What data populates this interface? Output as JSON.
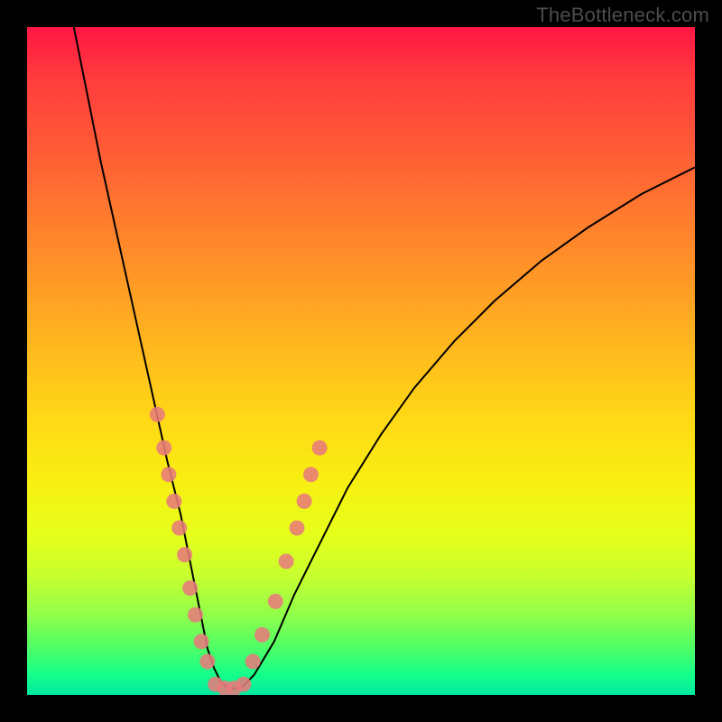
{
  "watermark": "TheBottleneck.com",
  "chart_data": {
    "type": "line",
    "title": "",
    "xlabel": "",
    "ylabel": "",
    "xlim": [
      0,
      100
    ],
    "ylim": [
      0,
      100
    ],
    "grid": false,
    "legend": false,
    "series": [
      {
        "name": "curve",
        "stroke": "#000000",
        "x": [
          7,
          9,
          11,
          13,
          15,
          17,
          19,
          21,
          22,
          23,
          24,
          25,
          26,
          27,
          28,
          29,
          30,
          32,
          34,
          37,
          40,
          44,
          48,
          53,
          58,
          64,
          70,
          77,
          84,
          92,
          100
        ],
        "y": [
          100,
          90,
          80,
          71,
          62,
          53,
          44,
          35,
          31,
          27,
          22,
          17,
          12,
          7,
          4,
          2,
          1,
          1,
          3,
          8,
          15,
          23,
          31,
          39,
          46,
          53,
          59,
          65,
          70,
          75,
          79
        ]
      },
      {
        "name": "markers-left",
        "marker": "circle",
        "color": "#e77b7b",
        "x": [
          19.5,
          20.5,
          21.2,
          22.0,
          22.8,
          23.6,
          24.4,
          25.2,
          26.1,
          27.0
        ],
        "y": [
          42,
          37,
          33,
          29,
          25,
          21,
          16,
          12,
          8,
          5
        ]
      },
      {
        "name": "markers-bottom",
        "marker": "circle",
        "color": "#e77b7b",
        "x": [
          28.2,
          29.6,
          31.0,
          32.4
        ],
        "y": [
          1.6,
          1.0,
          1.0,
          1.6
        ]
      },
      {
        "name": "markers-right",
        "marker": "circle",
        "color": "#e77b7b",
        "x": [
          33.8,
          35.2,
          37.2,
          38.8,
          40.4,
          41.5,
          42.5,
          43.8
        ],
        "y": [
          5,
          9,
          14,
          20,
          25,
          29,
          33,
          37
        ]
      }
    ]
  }
}
